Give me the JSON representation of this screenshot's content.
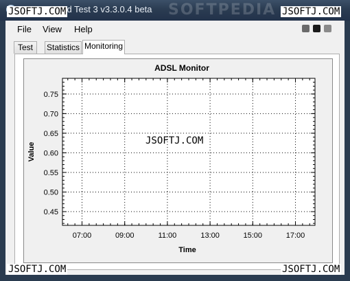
{
  "window": {
    "title": "ADSL Speed Test 3 v3.3.0.4 beta",
    "banner_watermark": "SOFTPEDIA"
  },
  "watermarks": {
    "top_left": "JSOFTJ.COM",
    "top_right": "JSOFTJ.COM",
    "center": "JSOFTJ.COM",
    "bottom_left": "JSOFTJ.COM",
    "bottom_right": "JSOFTJ.COM"
  },
  "menu": {
    "file": "File",
    "view": "View",
    "help": "Help"
  },
  "window_buttons": {
    "colors": [
      "#6a6a6a",
      "#1a1a1a",
      "#8a8a8a"
    ]
  },
  "tabs": [
    {
      "label": "Test",
      "active": false
    },
    {
      "label": "Statistics",
      "active": false
    },
    {
      "label": "Monitoring",
      "active": true
    }
  ],
  "chart_data": {
    "type": "line",
    "title": "ADSL Monitor",
    "xlabel": "Time",
    "ylabel": "Value",
    "x_ticks": [
      "07:00",
      "09:00",
      "11:00",
      "13:00",
      "15:00",
      "17:00"
    ],
    "y_ticks": [
      0.75,
      0.7,
      0.65,
      0.6,
      0.55,
      0.5,
      0.45
    ],
    "xlim": [
      "06:05",
      "17:55"
    ],
    "ylim": [
      0.415,
      0.79
    ],
    "grid": true,
    "series": []
  }
}
